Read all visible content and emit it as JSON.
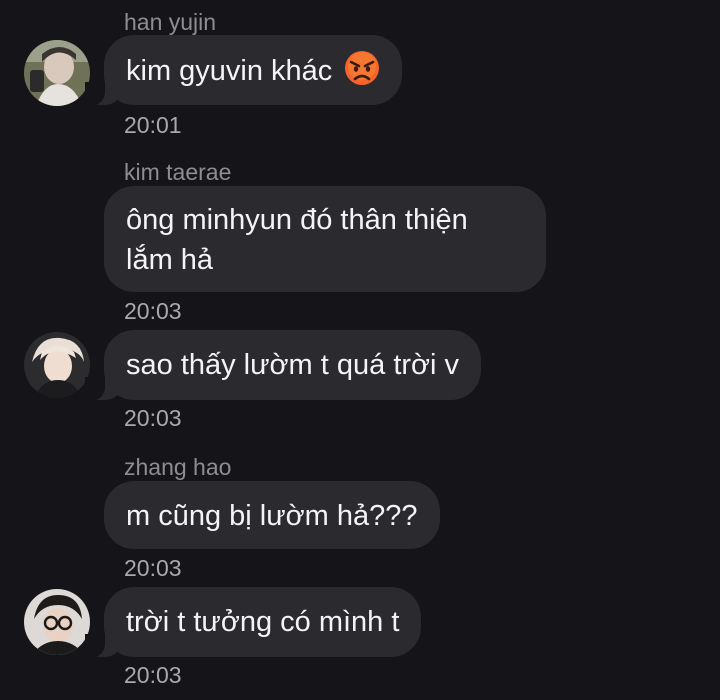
{
  "messages": [
    {
      "sender": "han yujin",
      "text": "kim gyuvin khác",
      "emoji": "angry-face",
      "time": "20:01"
    },
    {
      "sender": "kim taerae",
      "line1": "ông minhyun đó thân thiện",
      "line2": "lắm hả",
      "time": "20:03"
    },
    {
      "text": "sao thấy lườm t quá trời v",
      "time": "20:03"
    },
    {
      "sender": "zhang hao",
      "text": "m cũng bị lườm hả???",
      "time": "20:03"
    },
    {
      "text": "trời t tưởng có mình t",
      "time": "20:03"
    }
  ],
  "colors": {
    "background": "#151419",
    "bubble": "#2a2a2f",
    "message_text": "#f4f4f6",
    "meta_text": "#8e8d92"
  }
}
